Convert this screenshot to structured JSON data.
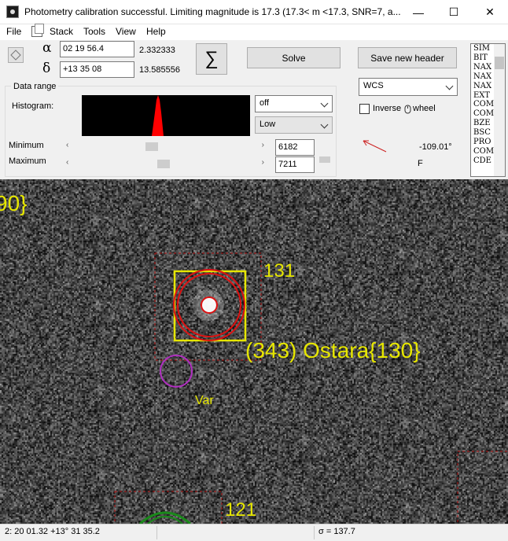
{
  "window": {
    "title": "Photometry calibration successful. Limiting magnitude is 17.3   (17.3< m <17.3, SNR=7, a...",
    "minimize": "—",
    "maximize": "☐",
    "close": "✕"
  },
  "menu": {
    "file": "File",
    "stack": "Stack",
    "tools": "Tools",
    "view": "View",
    "help": "Help"
  },
  "coords": {
    "alpha_symbol": "α",
    "delta_symbol": "δ",
    "ra_value": "02 19 56.4",
    "dec_value": "+13 35 08",
    "ra_decimal": "2.332333",
    "dec_decimal": "13.585556"
  },
  "buttons": {
    "sigma": "∑",
    "solve": "Solve",
    "save_header": "Save new header"
  },
  "data_range": {
    "group_title": "Data range",
    "histogram_label": "Histogram:",
    "minimum_label": "Minimum",
    "maximum_label": "Maximum",
    "minimum_value": "6182",
    "maximum_value": "7211",
    "stretch_option": "off",
    "stretch_mode": "Low"
  },
  "wcs": {
    "selected": "WCS",
    "inverse_label": "Inverse",
    "wheel_label": "wheel",
    "angle": "-109.01°",
    "flip": "F"
  },
  "header_lines": [
    "SIM",
    "BIT",
    "NAX",
    "NAX",
    "NAX",
    "EXT",
    "COM",
    "COM",
    "BZE",
    "BSC",
    "PRO",
    "COM",
    "CDE"
  ],
  "annotations": {
    "top_left_fragment": "90}",
    "star_131": "131",
    "asteroid": "(343) Ostara{130}",
    "var_label": "Var",
    "star_121": "121"
  },
  "colors": {
    "annotation_yellow": "#e6e600",
    "red_ring": "#dd1111",
    "var_circle": "#b030c0",
    "histogram_peak": "#ff0000"
  },
  "status": {
    "position": "2: 20  01.32   +13° 31  35.2",
    "middle": "",
    "sigma": "σ = 137.7"
  }
}
